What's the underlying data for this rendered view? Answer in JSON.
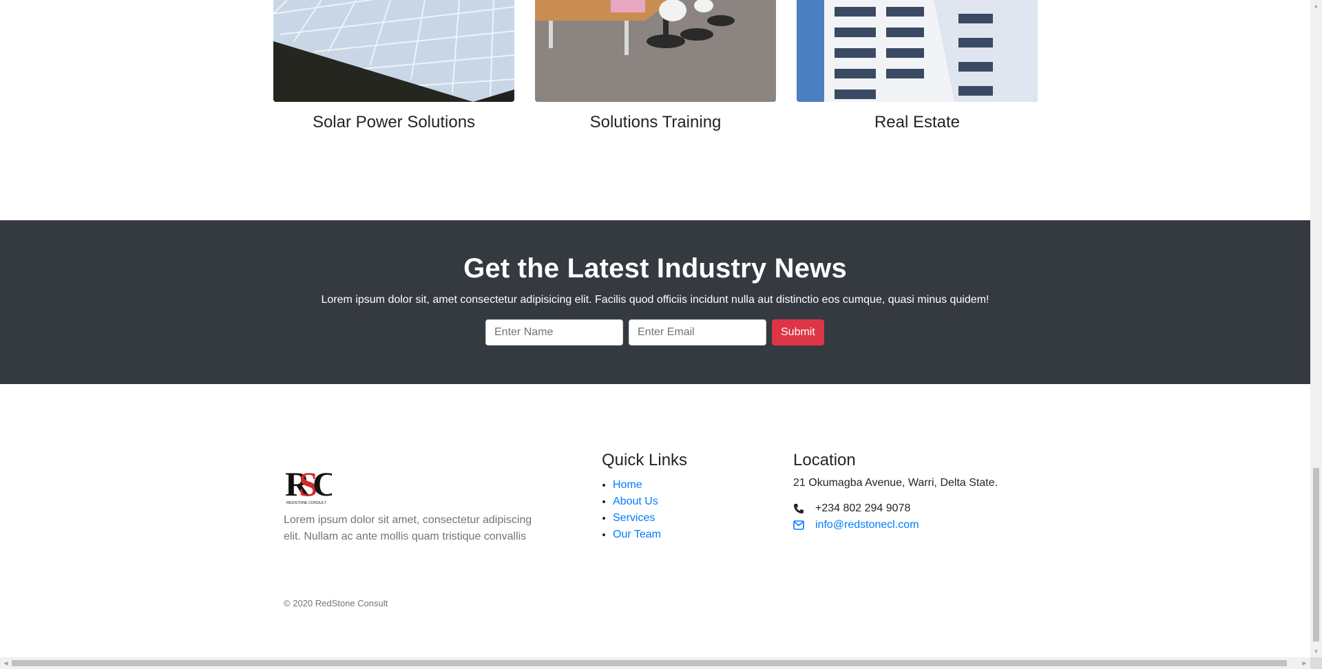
{
  "services": [
    {
      "title": "Solar Power Solutions",
      "image": "solar-panels-photo"
    },
    {
      "title": "Solutions Training",
      "image": "office-meeting-room-photo"
    },
    {
      "title": "Real Estate",
      "image": "modern-building-photo"
    }
  ],
  "newsletter": {
    "heading": "Get the Latest Industry News",
    "text": "Lorem ipsum dolor sit, amet consectetur adipisicing elit. Facilis quod officiis incidunt nulla aut distinctio eos cumque, quasi minus quidem!",
    "name_placeholder": "Enter Name",
    "email_placeholder": "Enter Email",
    "submit_label": "Submit",
    "bg_color": "#343a40",
    "button_color": "#dc3545"
  },
  "footer": {
    "logo_letters": "RSC",
    "logo_caption": "REDSTONE CONSULT",
    "about": "Lorem ipsum dolor sit amet, consectetur adipiscing elit. Nullam ac ante mollis quam tristique convallis",
    "quick_links_title": "Quick Links",
    "links": [
      "Home",
      "About Us",
      "Services",
      "Our Team"
    ],
    "location_title": "Location",
    "address": "21 Okumagba Avenue, Warri, Delta State.",
    "phone": "+234 802 294 9078",
    "email": "info@redstonecl.com",
    "copyright": "© 2020 RedStone Consult"
  },
  "icons": {
    "phone": "phone-icon",
    "email": "envelope-icon"
  },
  "colors": {
    "link": "#007bff",
    "muted": "#6c757d"
  }
}
